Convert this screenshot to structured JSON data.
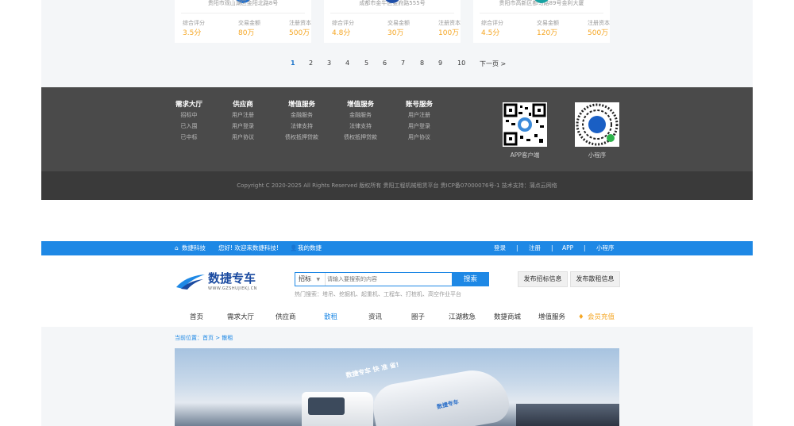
{
  "cards": [
    {
      "address": "贵阳市观山湖区金阳北路8号",
      "rating_label": "综合评分",
      "rating": "3.5分",
      "amount_label": "交易金额",
      "amount": "80万",
      "capital_label": "注册资本",
      "capital": "500万",
      "accent": "#1e6fd0"
    },
    {
      "address": "成都市金牛区金府路555号",
      "rating_label": "综合评分",
      "rating": "4.8分",
      "amount_label": "交易金额",
      "amount": "30万",
      "capital_label": "注册资本",
      "capital": "100万",
      "accent": "#1f4fa8"
    },
    {
      "address": "贵阳市高新区都匀路89号金利大厦",
      "rating_label": "综合评分",
      "rating": "4.5分",
      "amount_label": "交易金额",
      "amount": "120万",
      "capital_label": "注册资本",
      "capital": "500万",
      "accent": "#18a3a3"
    }
  ],
  "pagination": {
    "pages": [
      "1",
      "2",
      "3",
      "4",
      "5",
      "6",
      "7",
      "8",
      "9",
      "10"
    ],
    "current": "1",
    "next": "下一页 >"
  },
  "footer": {
    "columns": [
      {
        "heading": "需求大厅",
        "items": [
          "招标中",
          "已入围",
          "已中标"
        ]
      },
      {
        "heading": "供应商",
        "items": [
          "用户注册",
          "用户登录",
          "用户协议"
        ]
      },
      {
        "heading": "增值服务",
        "items": [
          "金融服务",
          "法律支持",
          "债权抵押贷款"
        ]
      },
      {
        "heading": "增值服务",
        "items": [
          "金融服务",
          "法律支持",
          "债权抵押贷款"
        ]
      },
      {
        "heading": "账号服务",
        "items": [
          "用户注册",
          "用户登录",
          "用户协议"
        ]
      }
    ],
    "qr_app_caption": "APP客户端",
    "qr_mini_caption": "小程序",
    "copyright": "Copyright C 2020-2025 All Rights Reserved 版权所有 贵阳工程机械租赁平台 贵ICP备07000076号-1    技术支持：蒲点云网络"
  },
  "topbar": {
    "home": "数捷科技",
    "welcome": "您好! 欢迎来数捷科技!",
    "my": "我的数捷",
    "login": "登录",
    "register": "注册",
    "app": "APP",
    "mini": "小程序",
    "divider": "|"
  },
  "brand": {
    "name": "数捷专车",
    "sub": "WWW.GZSHUJIEKJ.CN"
  },
  "search": {
    "category": "招标",
    "placeholder": "请输入要搜索的内容",
    "button": "搜索",
    "hot": "热门搜索：塔吊、挖掘机、起重机、工程车、打桩机、高空作业平台"
  },
  "actions": {
    "publish_tender": "发布招标信息",
    "publish_lease": "发布散租信息"
  },
  "nav": {
    "items": [
      "首页",
      "需求大厅",
      "供应商",
      "散租",
      "资讯",
      "圈子",
      "江湖救急",
      "数捷商城",
      "增值服务"
    ],
    "active": "散租",
    "vip": "会员充值"
  },
  "breadcrumb": "当前位置：首页 > 散租",
  "banner": {
    "slogan": "数捷专车   快   准   省!",
    "tank_text": "数捷专车"
  },
  "colors": {
    "primary": "#1e88e5",
    "highlight": "#f5a623",
    "footer": "#4a4a4a"
  }
}
